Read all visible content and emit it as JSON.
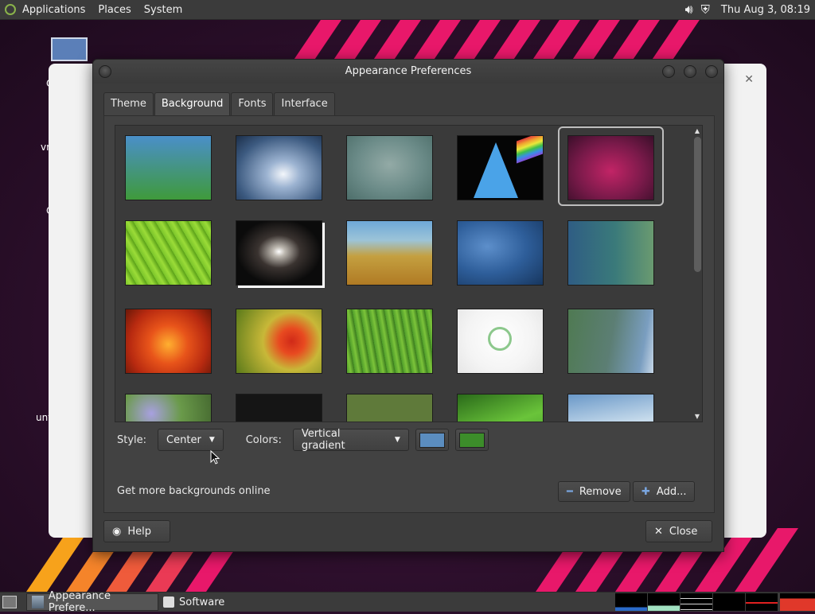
{
  "top_panel": {
    "menus": [
      "Applications",
      "Places",
      "System"
    ],
    "clock": "Thu Aug  3, 08:19",
    "icons": [
      "distro-logo-icon",
      "volume-icon",
      "shield-icon"
    ]
  },
  "desktop": {
    "icon_labels": [
      "",
      "C",
      "vm",
      "C",
      "unt"
    ]
  },
  "back_window": {
    "close_label": "✕"
  },
  "dialog": {
    "title": "Appearance Preferences",
    "tabs": [
      {
        "label": "Theme",
        "active": false
      },
      {
        "label": "Background",
        "active": true
      },
      {
        "label": "Fonts",
        "active": false
      },
      {
        "label": "Interface",
        "active": false
      }
    ],
    "wallpapers": [
      {
        "name": "blue-green-gradient",
        "selected": false
      },
      {
        "name": "water-drop",
        "selected": false
      },
      {
        "name": "teal-blur",
        "selected": false
      },
      {
        "name": "arch-prism",
        "selected": false
      },
      {
        "name": "arch-pink",
        "selected": true
      },
      {
        "name": "green-leaf",
        "selected": false
      },
      {
        "name": "galaxy",
        "selected": false
      },
      {
        "name": "golden-grass",
        "selected": false
      },
      {
        "name": "blue-abstract",
        "selected": false
      },
      {
        "name": "teal-bokeh",
        "selected": false
      },
      {
        "name": "orange-flower",
        "selected": false
      },
      {
        "name": "red-flower",
        "selected": false
      },
      {
        "name": "green-grass",
        "selected": false
      },
      {
        "name": "mate-white",
        "selected": false
      },
      {
        "name": "green-blue-wave",
        "selected": false
      },
      {
        "name": "purple-flowers",
        "selected": false
      },
      {
        "name": "mate-dark",
        "selected": false
      },
      {
        "name": "mate-green",
        "selected": false
      },
      {
        "name": "green-leaf-2",
        "selected": false
      },
      {
        "name": "blue-wave",
        "selected": false
      }
    ],
    "style_label": "Style:",
    "style_value": "Center",
    "colors_label": "Colors:",
    "colors_value": "Vertical gradient",
    "primary_color": "#5b8dbf",
    "secondary_color": "#3c8d2a",
    "online_link": "Get more backgrounds online",
    "remove_label": "Remove",
    "add_label": "Add...",
    "help_label": "Help",
    "close_label": "Close"
  },
  "taskbar": {
    "tasks": [
      {
        "label": "Appearance Prefere...",
        "active": true
      },
      {
        "label": "Software",
        "active": false
      }
    ]
  }
}
